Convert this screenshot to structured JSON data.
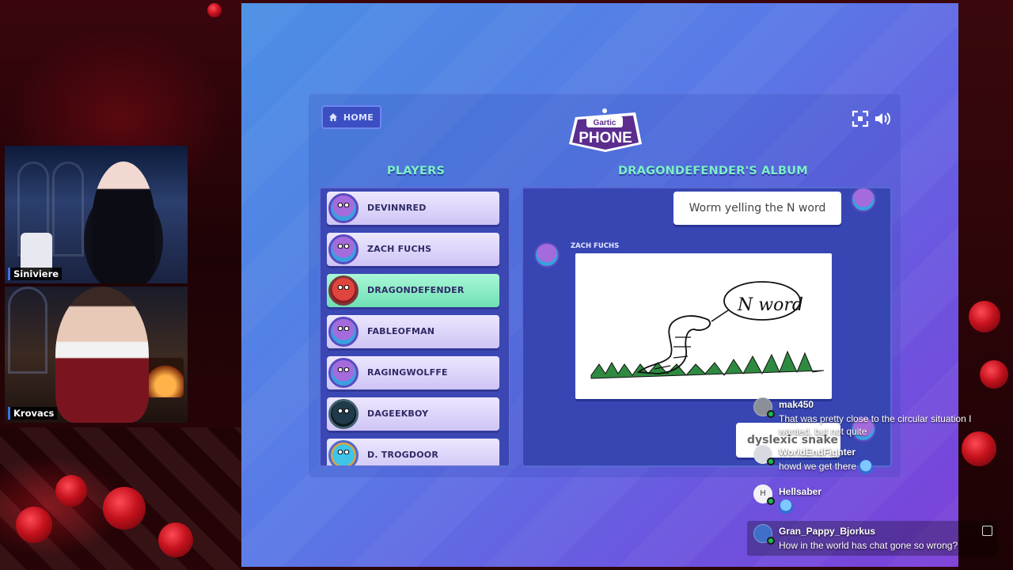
{
  "stream": {
    "webcams": [
      {
        "label": "Siniviere"
      },
      {
        "label": "Krovacs"
      }
    ]
  },
  "game": {
    "home_label": "HOME",
    "logo": {
      "line1": "Gartic",
      "line2": "PHONE"
    },
    "icons": {
      "fullscreen": "fullscreen-icon",
      "sound": "speaker-icon"
    },
    "players_title": "PLAYERS",
    "album_title": "DRAGONDEFENDER'S ALBUM",
    "players": [
      {
        "name": "DEVINNRED",
        "avatar": "purple"
      },
      {
        "name": "ZACH FUCHS",
        "avatar": "purple"
      },
      {
        "name": "DRAGONDEFENDER",
        "avatar": "red",
        "active": true
      },
      {
        "name": "FABLEOFMAN",
        "avatar": "purple"
      },
      {
        "name": "RAGINGWOLFFE",
        "avatar": "purple"
      },
      {
        "name": "DAGEEKBOY",
        "avatar": "dark"
      },
      {
        "name": "D. TROGDOOR",
        "avatar": "cyan"
      }
    ],
    "album": {
      "prompt_1": "Worm yelling the N word",
      "drawer": "ZACH FUCHS",
      "drawing_text": "N word",
      "prompt_2": "dyslexic snake"
    }
  },
  "chat": {
    "messages": [
      {
        "user": "mak450",
        "text": "That was pretty close to the circular situation I wanted, but not quite",
        "user_color": "#ffffff"
      },
      {
        "user": "WorldEndFighter",
        "text": "howd we get there",
        "has_emote": true
      },
      {
        "user": "Hellsaber",
        "avatar_letter": "H",
        "text": "",
        "has_emote": true
      },
      {
        "user": "Gran_Pappy_Bjorkus",
        "text": "How in the world has chat gone so wrong?"
      }
    ]
  },
  "colors": {
    "accent_green": "#7cf0c6",
    "panel_blue": "#3b48b4",
    "active_player": "#6fe0b6"
  }
}
